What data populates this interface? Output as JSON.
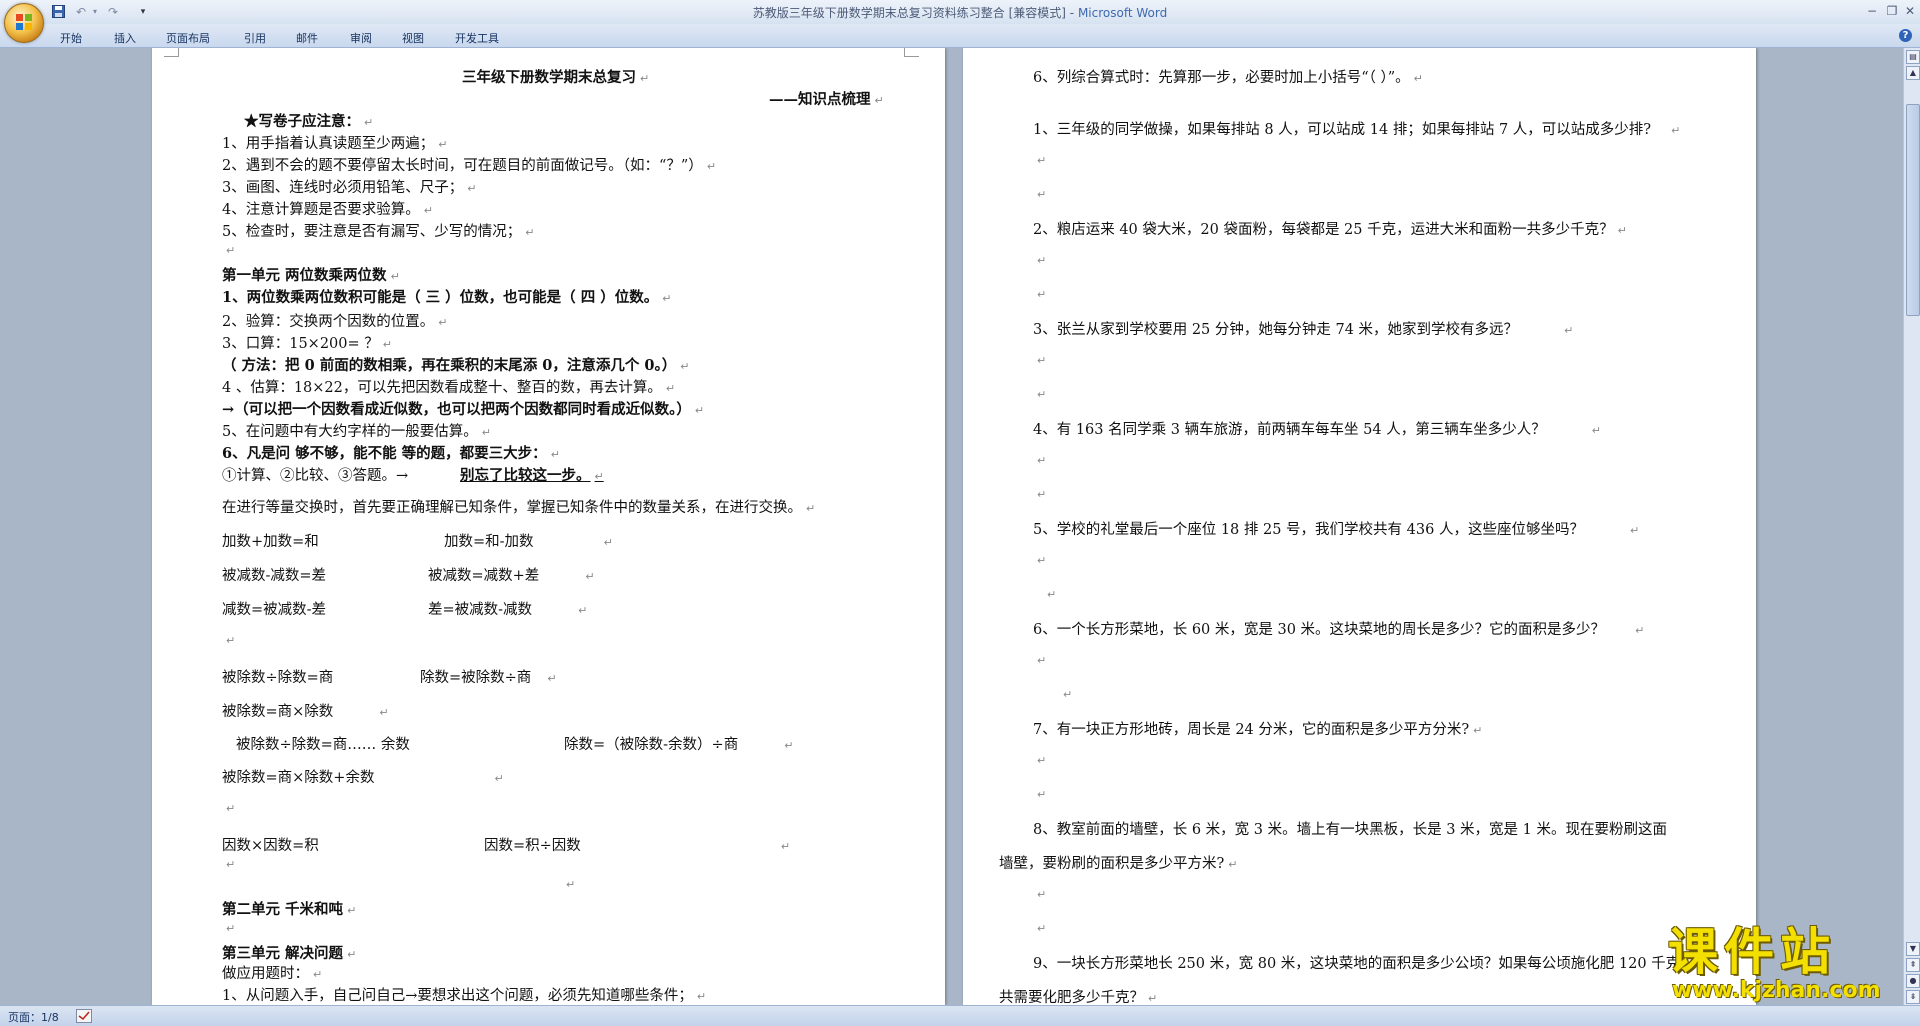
{
  "window": {
    "title": "苏教版三年级下册数学期末总复习资料练习整合 [兼容模式]",
    "app_name": "Microsoft Word",
    "minimize_glyph": "−",
    "restore_glyph": "❐",
    "close_glyph": "✕"
  },
  "quick_access": {
    "save_glyph": "💾",
    "undo_glyph": "↶",
    "redo_glyph": "↷",
    "customize_glyph": "▾"
  },
  "ribbon": {
    "tabs": [
      "开始",
      "插入",
      "页面布局",
      "引用",
      "邮件",
      "审阅",
      "视图",
      "开发工具"
    ],
    "help_glyph": "?"
  },
  "page1": {
    "title": "三年级下册数学期末总复习",
    "subtitle": "——知识点梳理",
    "lines": [
      "★写卷子应注意：",
      "1、用手指着认真读题至少两遍；",
      "2、遇到不会的题不要停留太长时间，可在题目的前面做记号。（如：“？”）",
      "3、画图、连线时必须用铅笔、尺子；",
      "4、注意计算题是否要求验算。",
      "5、检查时，要注意是否有漏写、少写的情况；",
      "第一单元    两位数乘两位数",
      "1、两位数乘两位数积可能是（ 三 ）位数，也可能是（ 四 ）位数。",
      "2、验算：交换两个因数的位置。",
      "3、口算：15×200= ？",
      "（ 方法：把 0 前面的数相乘，再在乘积的末尾添 0，注意添几个 0。）",
      "4 、估算：18×22，可以先把因数看成整十、整百的数，再去计算。",
      "→（可以把一个因数看成近似数，也可以把两个因数都同时看成近似数。）",
      "5、在问题中有大约字样的一般要估算。",
      "6、凡是问 够不够，能不能 等的题，都要三大步：",
      "①计算、②比较、③答题。→",
      "别忘了比较这一步。",
      "在进行等量交换时，首先要正确理解已知条件，掌握已知条件中的数量关系，在进行交换。",
      "加数+加数=和",
      "加数=和-加数",
      "被减数-减数=差",
      "被减数=减数+差",
      "减数=被减数-差",
      "差=被减数-减数",
      "被除数÷除数=商",
      "除数=被除数÷商",
      "被除数=商×除数",
      "被除数÷除数=商……  余数",
      "除数=（被除数-余数）÷商",
      "被除数=商×除数+余数",
      "因数×因数=积",
      "因数=积÷因数",
      "第二单元      千米和吨",
      "第三单元      解决问题",
      "做应用题时：",
      "1、从问题入手，自己问自己→要想求出这个问题，必须先知道哪些条件；"
    ]
  },
  "page2": {
    "lines": [
      "6、列综合算式时：先算那一步，必要时加上小括号“（      ）”。",
      "1、三年级的同学做操，如果每排站 8 人，可以站成 14 排；如果每排站 7 人，可以站成多少排?",
      "2、粮店运来 40 袋大米，20 袋面粉，每袋都是 25 千克，运进大米和面粉一共多少千克？",
      "3、张兰从家到学校要用 25 分钟，她每分钟走 74 米，她家到学校有多远？",
      "4、有 163 名同学乘 3 辆车旅游，前两辆车每车坐 54 人，第三辆车坐多少人？",
      "5、学校的礼堂最后一个座位 18 排 25 号，我们学校共有 436 人，这些座位够坐吗？",
      "6、一个长方形菜地，长 60 米，宽是 30 米。这块菜地的周长是多少？它的面积是多少？",
      "7、有一块正方形地砖，周长是 24 分米，它的面积是多少平方分米?",
      "8、教室前面的墙壁，长 6 米，宽 3 米。墙上有一块黑板，长是 3 米，宽是 1 米。现在要粉刷这面",
      "墙壁，要粉刷的面积是多少平方米?",
      "9、一块长方形菜地长 250 米，宽 80 米，这块菜地的面积是多少公顷？如果每公顷施化肥 120 千克，",
      "共需要化肥多少千克？"
    ]
  },
  "paragraph_mark": "↵",
  "status": {
    "page": "页面：1/8"
  },
  "watermark": {
    "title": "课件站",
    "url": "www.kjzhan.com"
  }
}
